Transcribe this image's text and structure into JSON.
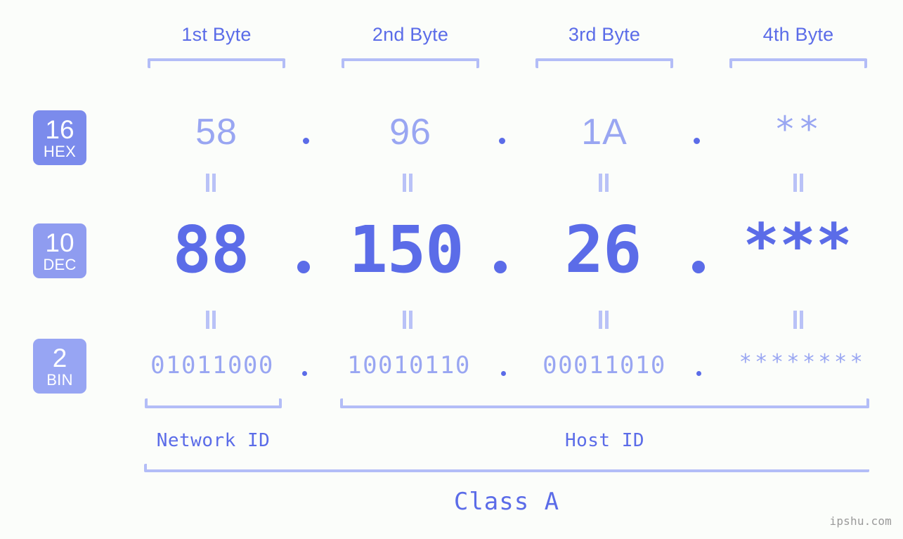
{
  "background_color": "#fbfdfa",
  "accent_color": "#5b6ce8",
  "accent_light_color": "#99a6f2",
  "bracket_color": "#b3bdf7",
  "headers": [
    {
      "label": "1st Byte"
    },
    {
      "label": "2nd Byte"
    },
    {
      "label": "3rd Byte"
    },
    {
      "label": "4th Byte"
    }
  ],
  "rows": [
    {
      "base_number": "16",
      "base_abbr": "HEX",
      "badge_color": "#7b8bec",
      "values": [
        "58",
        "96",
        "1A",
        "**"
      ]
    },
    {
      "base_number": "10",
      "base_abbr": "DEC",
      "badge_color": "#8f9cf0",
      "values": [
        "88",
        "150",
        "26",
        "***"
      ]
    },
    {
      "base_number": "2",
      "base_abbr": "BIN",
      "badge_color": "#97a5f3",
      "values": [
        "01011000",
        "10010110",
        "00011010",
        "********"
      ]
    }
  ],
  "separator": ".",
  "equality_symbol": "=",
  "segments": [
    {
      "label": "Network ID"
    },
    {
      "label": "Host ID"
    }
  ],
  "class_label": "Class A",
  "watermark": "ipshu.com"
}
